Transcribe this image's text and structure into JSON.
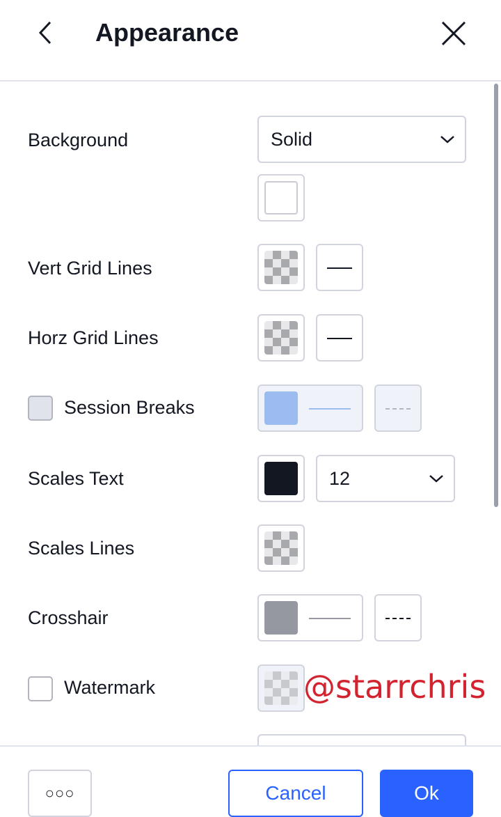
{
  "header": {
    "title": "Appearance"
  },
  "rows": {
    "background": {
      "label": "Background",
      "select_value": "Solid"
    },
    "vert_grid": {
      "label": "Vert Grid Lines"
    },
    "horz_grid": {
      "label": "Horz Grid Lines"
    },
    "session_breaks": {
      "label": "Session Breaks",
      "checked": false,
      "swatch_color": "#9cbcf0"
    },
    "scales_text": {
      "label": "Scales Text",
      "swatch_color": "#131722",
      "font_size": "12"
    },
    "scales_lines": {
      "label": "Scales Lines"
    },
    "crosshair": {
      "label": "Crosshair",
      "swatch_color": "#9598a1"
    },
    "watermark": {
      "label": "Watermark",
      "checked": false
    }
  },
  "footer": {
    "more_label": "○○○",
    "cancel_label": "Cancel",
    "ok_label": "Ok"
  },
  "overlay": {
    "watermark_text": "@starrchris"
  },
  "colors": {
    "accent": "#2962ff",
    "watermark_red": "#d2232f"
  }
}
